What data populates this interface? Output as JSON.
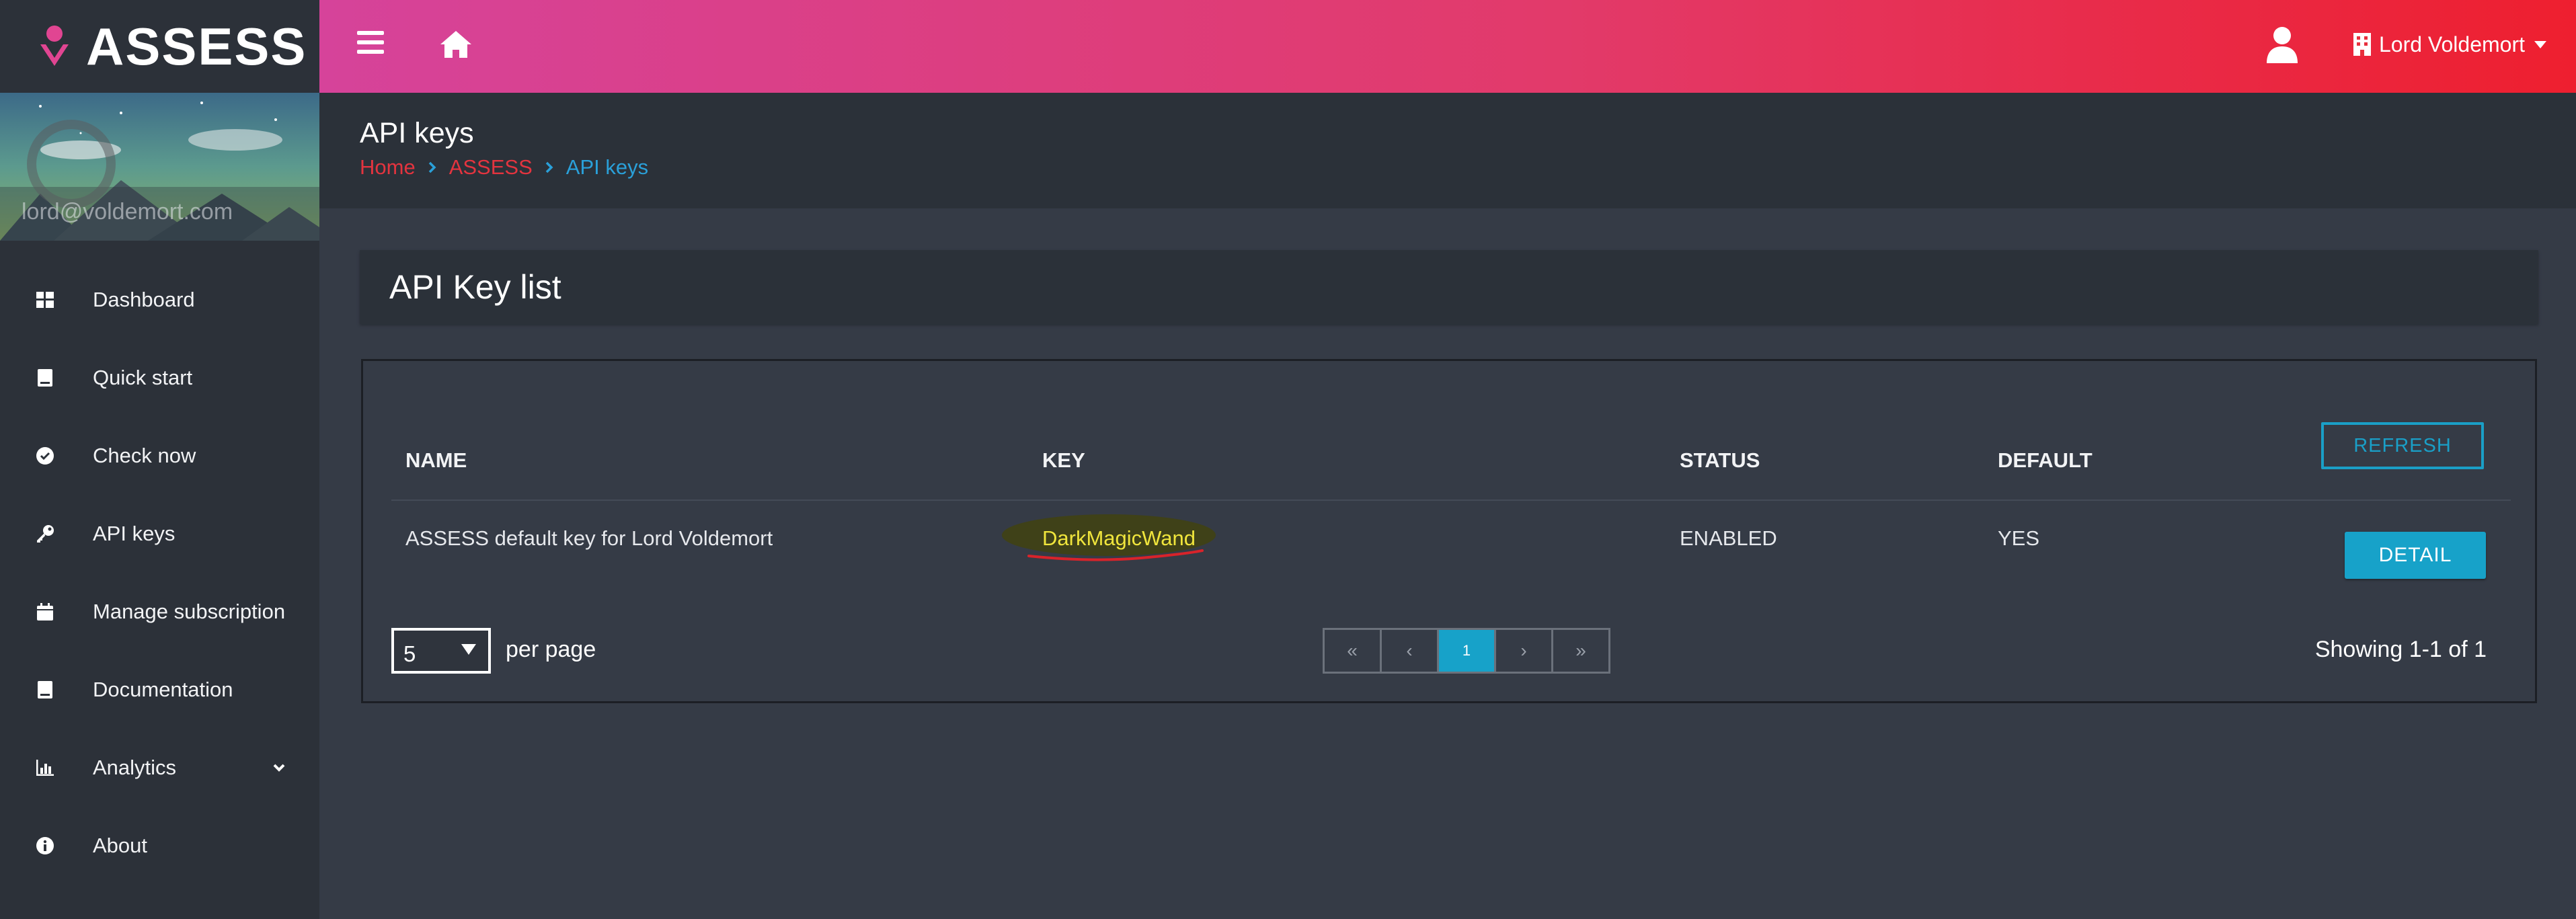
{
  "brand": {
    "name": "ASSESS"
  },
  "profile": {
    "email": "lord@voldemort.com"
  },
  "nav": [
    {
      "label": "Dashboard",
      "icon": "dashboard-icon"
    },
    {
      "label": "Quick start",
      "icon": "book-icon"
    },
    {
      "label": "Check now",
      "icon": "check-circle-icon"
    },
    {
      "label": "API keys",
      "icon": "key-icon"
    },
    {
      "label": "Manage subscription",
      "icon": "calendar-icon"
    },
    {
      "label": "Documentation",
      "icon": "book-icon"
    },
    {
      "label": "Analytics",
      "icon": "chart-icon",
      "has_submenu": true
    },
    {
      "label": "About",
      "icon": "info-icon"
    }
  ],
  "topbar": {
    "account_name": "Lord Voldemort"
  },
  "page": {
    "title": "API keys",
    "breadcrumb": [
      "Home",
      "ASSESS",
      "API keys"
    ]
  },
  "card": {
    "title": "API Key list"
  },
  "table": {
    "columns": [
      "NAME",
      "KEY",
      "STATUS",
      "DEFAULT"
    ],
    "rows": [
      {
        "name": "ASSESS default key for Lord Voldemort",
        "key": "DarkMagicWand",
        "status": "ENABLED",
        "default": "YES"
      }
    ],
    "refresh_label": "REFRESH",
    "detail_label": "DETAIL"
  },
  "pagination": {
    "per_page": "5",
    "per_page_label": "per page",
    "first": "«",
    "prev": "‹",
    "current": "1",
    "next": "›",
    "last": "»",
    "showing": "Showing 1-1 of 1"
  },
  "colors": {
    "topbar_start": "#d6439a",
    "topbar_end": "#ee1f2f",
    "sidebar_bg": "#2c3139",
    "content_bg": "#353b46",
    "accent_cyan": "#17a2c9",
    "breadcrumb_link": "#e3343f",
    "breadcrumb_current": "#2aa0d9",
    "key_highlight": "#f0e53c"
  }
}
